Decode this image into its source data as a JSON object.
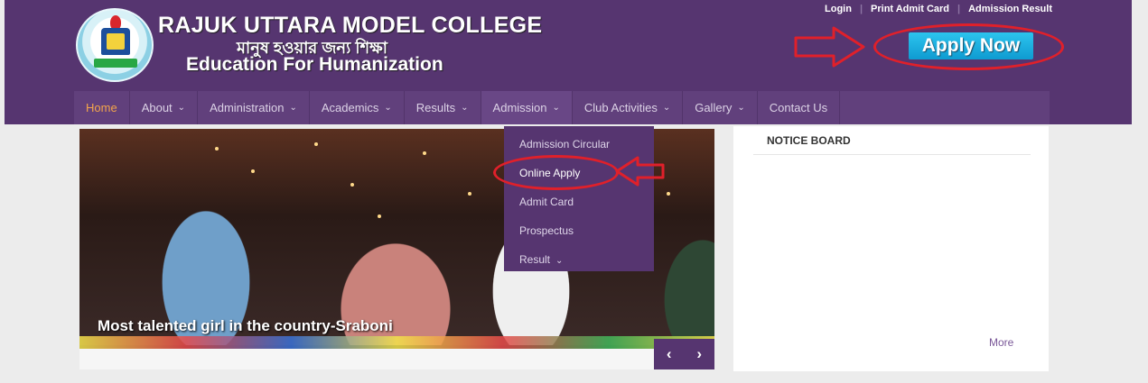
{
  "header": {
    "title": "RAJUK UTTARA MODEL COLLEGE",
    "title_bn": "মানুষ হওয়ার জন্য শিক্ষা",
    "motto": "Education For Humanization",
    "top_links": [
      "Login",
      "Print Admit Card",
      "Admission Result"
    ],
    "apply_now": "Apply Now",
    "annotation_color": "#e0202a",
    "brand_color": "#563570"
  },
  "nav": {
    "items": [
      {
        "label": "Home",
        "active": true,
        "has_menu": false
      },
      {
        "label": "About",
        "has_menu": true
      },
      {
        "label": "Administration",
        "has_menu": true
      },
      {
        "label": "Academics",
        "has_menu": true
      },
      {
        "label": "Results",
        "has_menu": true
      },
      {
        "label": "Admission",
        "has_menu": true
      },
      {
        "label": "Club Activities",
        "has_menu": true
      },
      {
        "label": "Gallery",
        "has_menu": true
      },
      {
        "label": "Contact Us",
        "has_menu": false
      }
    ],
    "chevron": "⌄"
  },
  "admission_menu": {
    "items": [
      "Admission Circular",
      "Online Apply",
      "Admit Card",
      "Prospectus",
      "Result"
    ],
    "highlighted": "Online Apply"
  },
  "slider": {
    "caption": "Most talented girl in the country-Sraboni",
    "prev": "‹",
    "next": "›"
  },
  "notice_board": {
    "title": "NOTICE BOARD",
    "more": "More"
  }
}
